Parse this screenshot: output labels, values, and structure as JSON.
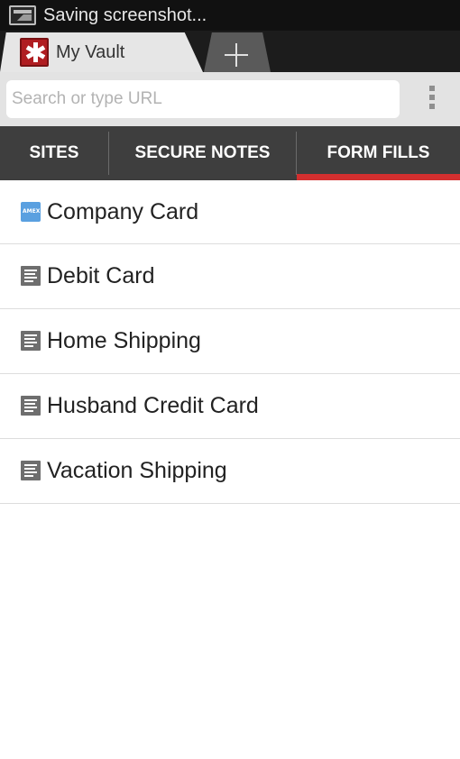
{
  "status_bar": {
    "text": "Saving screenshot..."
  },
  "browser_tabs": {
    "active_title": "My Vault"
  },
  "url_bar": {
    "placeholder": "Search or type URL"
  },
  "vault_tabs": [
    {
      "label": "SITES"
    },
    {
      "label": "SECURE NOTES"
    },
    {
      "label": "FORM FILLS",
      "selected": true
    }
  ],
  "accent_color": "#d32f2f",
  "items": [
    {
      "label": "Company Card",
      "icon": "amex-card-icon"
    },
    {
      "label": "Debit Card",
      "icon": "form-fill-icon"
    },
    {
      "label": "Home Shipping",
      "icon": "form-fill-icon"
    },
    {
      "label": "Husband Credit Card",
      "icon": "form-fill-icon"
    },
    {
      "label": "Vacation Shipping",
      "icon": "form-fill-icon"
    }
  ]
}
